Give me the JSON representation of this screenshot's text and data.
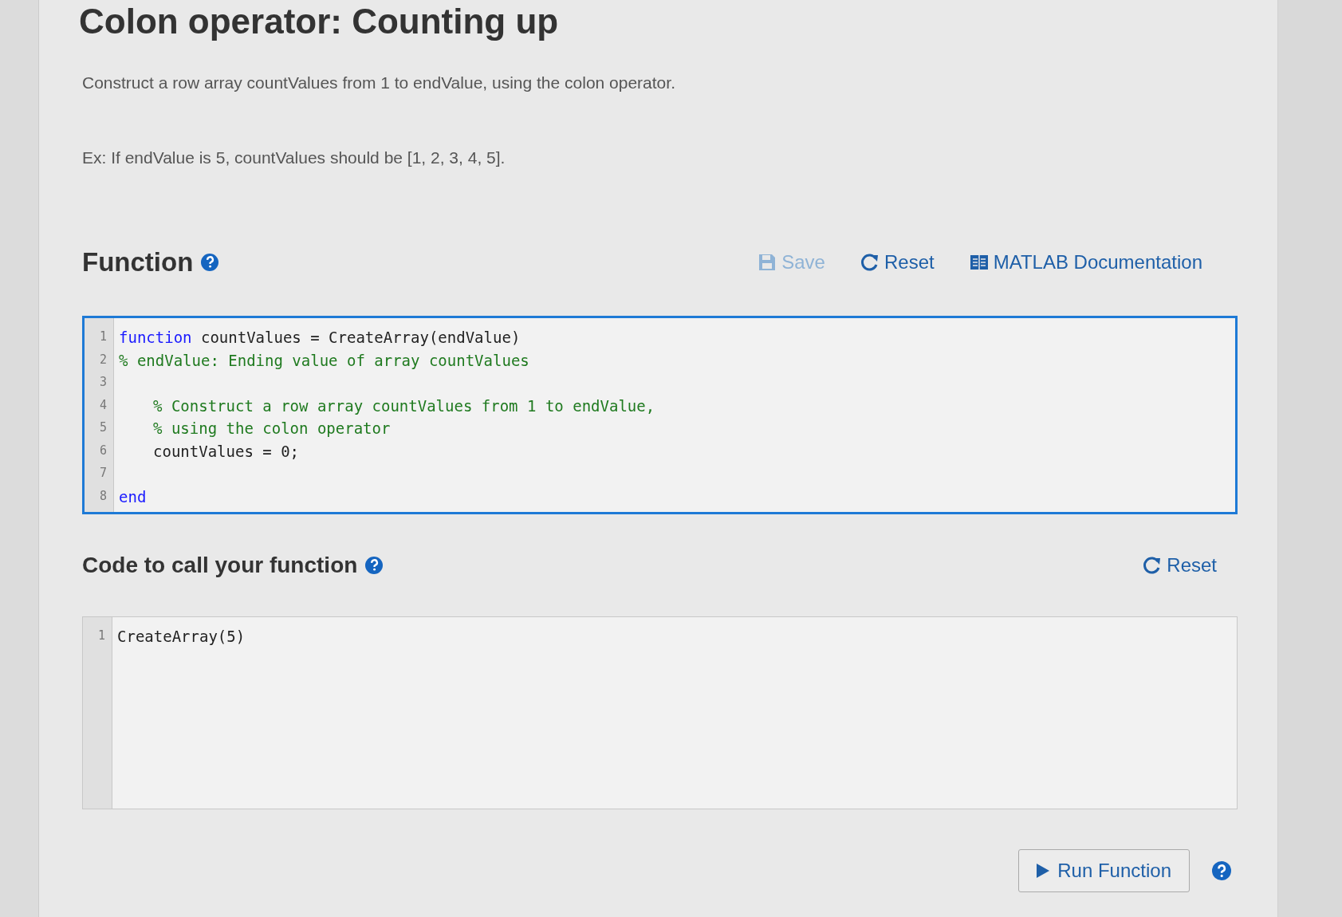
{
  "title": "Colon operator: Counting up",
  "description": "Construct a row array countValues from 1 to endValue, using the colon operator.",
  "example": "Ex: If endValue is 5, countValues should be [1, 2, 3, 4, 5].",
  "function_section": {
    "heading": "Function",
    "toolbar": [
      {
        "kind": "save",
        "label": "Save",
        "disabled": true
      },
      {
        "kind": "reset",
        "label": "Reset",
        "disabled": false
      },
      {
        "kind": "docs",
        "label": "MATLAB Documentation",
        "disabled": false
      }
    ],
    "editor": {
      "focused": true,
      "lines": [
        {
          "number": "1",
          "segments": [
            {
              "kind": "keyword",
              "text": "function"
            },
            {
              "kind": "plain",
              "text": " countValues = CreateArray(endValue)"
            }
          ]
        },
        {
          "number": "2",
          "segments": [
            {
              "kind": "comment",
              "text": "% endValue: Ending value of array countValues"
            }
          ]
        },
        {
          "number": "3"
        },
        {
          "number": "4",
          "indented": true,
          "segments": [
            {
              "kind": "comment",
              "text": "% Construct a row array countValues from 1 to endValue,"
            }
          ]
        },
        {
          "number": "5",
          "indented": true,
          "segments": [
            {
              "kind": "comment",
              "text": "% using the colon operator"
            }
          ]
        },
        {
          "number": "6",
          "indented": true,
          "segments": [
            {
              "kind": "plain",
              "text": "countValues = 0;"
            }
          ]
        },
        {
          "number": "7"
        },
        {
          "number": "8",
          "segments": [
            {
              "kind": "keyword",
              "text": "end"
            }
          ]
        }
      ]
    }
  },
  "call_section": {
    "heading": "Code to call your function",
    "toolbar": [
      {
        "kind": "reset",
        "label": "Reset",
        "disabled": false
      }
    ],
    "editor": {
      "focused": false,
      "lines": [
        {
          "number": "1",
          "segments": [
            {
              "kind": "plain",
              "text": "CreateArray(5)"
            }
          ]
        }
      ]
    }
  },
  "run_button": {
    "label": "Run Function"
  }
}
